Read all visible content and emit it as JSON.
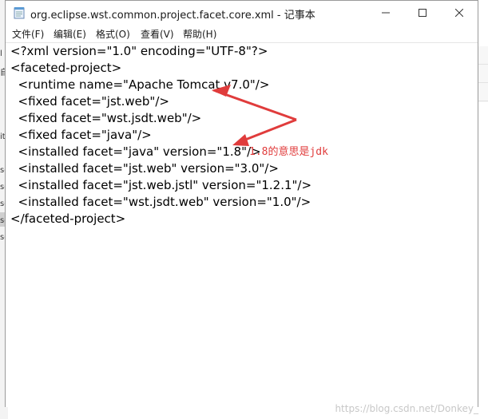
{
  "window": {
    "title": "org.eclipse.wst.common.project.facet.core.xml - 记事本",
    "icon": "notepad-icon",
    "controls": [
      "minimize-icon",
      "maximize-icon",
      "close-icon"
    ]
  },
  "menu": {
    "items": [
      "文件(F)",
      "编辑(E)",
      "格式(O)",
      "查看(V)",
      "帮助(H)"
    ]
  },
  "editor": {
    "lines": [
      "<?xml version=\"1.0\" encoding=\"UTF-8\"?>",
      "<faceted-project>",
      "  <runtime name=\"Apache Tomcat v7.0\"/>",
      "  <fixed facet=\"jst.web\"/>",
      "  <fixed facet=\"wst.jsdt.web\"/>",
      "  <fixed facet=\"java\"/>",
      "  <installed facet=\"java\" version=\"1.8\"/>",
      "  <installed facet=\"jst.web\" version=\"3.0\"/>",
      "  <installed facet=\"jst.web.jstl\" version=\"1.2.1\"/>",
      "  <installed facet=\"wst.jsdt.web\" version=\"1.0\"/>",
      "</faceted-project>"
    ]
  },
  "annotation": {
    "text": "1.8的意思是jdk",
    "color": "#e03c3c"
  },
  "background": {
    "left_fragments": [
      "l",
      "自",
      "it",
      "se",
      "se",
      "se",
      "se",
      "se"
    ]
  },
  "watermark": "https://blog.csdn.net/Donkey_"
}
